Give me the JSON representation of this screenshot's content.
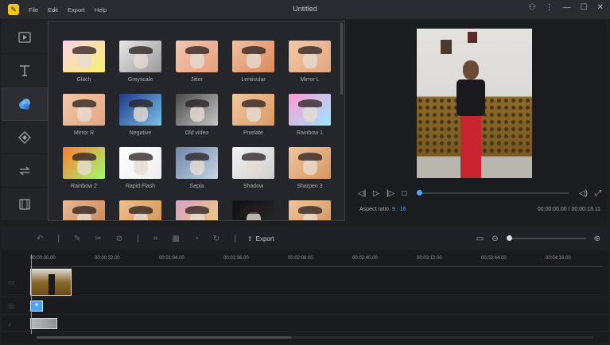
{
  "window": {
    "title": "Untitled"
  },
  "menu": {
    "items": [
      "File",
      "Edit",
      "Export",
      "Help"
    ]
  },
  "icons": {
    "app": "app-logo",
    "window_controls": [
      "user-icon",
      "more-icon",
      "minimize-icon",
      "maximize-icon",
      "close-icon"
    ],
    "nav": [
      "media-icon",
      "text-icon",
      "filters-icon",
      "overlay-icon",
      "transition-icon",
      "film-icon"
    ]
  },
  "effects": [
    {
      "name": "Glitch",
      "colors": [
        "#ffd2e8",
        "#f7f06a"
      ]
    },
    {
      "name": "Greyscale",
      "colors": [
        "#e8e8e8",
        "#9a9a9a"
      ]
    },
    {
      "name": "Jitter",
      "colors": [
        "#f5c6b3",
        "#e6a07a"
      ]
    },
    {
      "name": "Lenticular",
      "colors": [
        "#f2c0a0",
        "#d98a60"
      ]
    },
    {
      "name": "Mirror L",
      "colors": [
        "#f4c8a8",
        "#e3a680"
      ]
    },
    {
      "name": "Mirror R",
      "colors": [
        "#f4c8a8",
        "#e3a680"
      ]
    },
    {
      "name": "Negative",
      "colors": [
        "#1e3a8a",
        "#7cc0e8"
      ]
    },
    {
      "name": "Old video",
      "colors": [
        "#4a4a4a",
        "#c6c6c6"
      ]
    },
    {
      "name": "Pixelate",
      "colors": [
        "#f2c8a0",
        "#d89a66"
      ]
    },
    {
      "name": "Rainbow 1",
      "colors": [
        "#ff9ad4",
        "#9ae8ff"
      ]
    },
    {
      "name": "Rainbow 2",
      "colors": [
        "#ff7a30",
        "#9cff70"
      ]
    },
    {
      "name": "Rapid Flash",
      "colors": [
        "#ffffff",
        "#eeeeee"
      ]
    },
    {
      "name": "Sepia",
      "colors": [
        "#6e86a8",
        "#c6d4e6"
      ]
    },
    {
      "name": "Shadow",
      "colors": [
        "#f2f2f2",
        "#cfcfcf"
      ]
    },
    {
      "name": "Sharpen 3",
      "colors": [
        "#f0c4a0",
        "#d8965e"
      ]
    },
    {
      "name": "",
      "colors": [
        "#e8b896",
        "#c9824e"
      ]
    },
    {
      "name": "",
      "colors": [
        "#f0c08c",
        "#d09050"
      ]
    },
    {
      "name": "",
      "colors": [
        "#d6a0c8",
        "#f0d070"
      ]
    },
    {
      "name": "",
      "colors": [
        "#111111",
        "#2a2a2a"
      ]
    },
    {
      "name": "",
      "colors": [
        "#f2c49c",
        "#d4925a"
      ]
    }
  ],
  "preview": {
    "aspect_label": "Aspect ratio",
    "aspect_value": "9 : 16",
    "timecode": "00:00:00.00 / 00:00:13.11",
    "playback_position": 0
  },
  "toolbar": {
    "export_label": "Export",
    "zoom_level": 0
  },
  "ruler": [
    "00:00:00.00",
    "00:00:32.00",
    "00:01:04.00",
    "00:01:36.00",
    "00:02:08.00",
    "00:02:40.00",
    "00:03:12.00",
    "00:03:44.00",
    "00:04:16.00"
  ],
  "colors": {
    "accent": "#4fa3ff",
    "brand": "#f5c518"
  }
}
